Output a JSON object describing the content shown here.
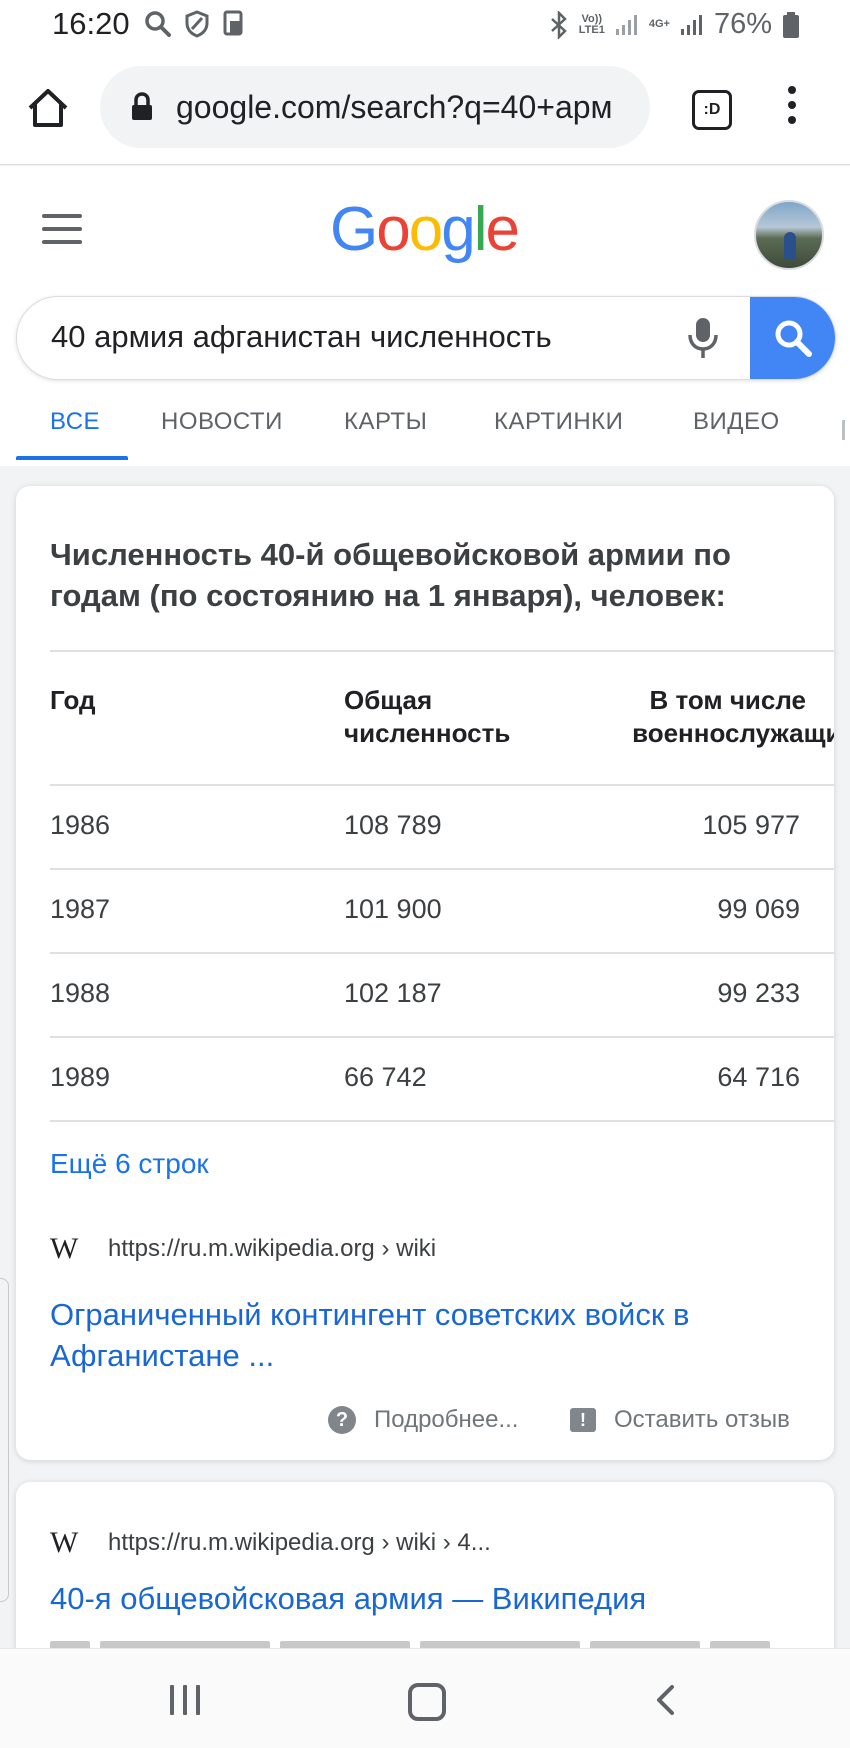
{
  "status": {
    "time": "16:20",
    "battery": "76%",
    "volte": "Vo))",
    "lte": "LTE1",
    "net": "4G+"
  },
  "browser": {
    "url": "google.com/search?q=40+арм",
    "tab_label": ":D"
  },
  "search": {
    "query": "40 армия афганистан численность"
  },
  "tabs": [
    "ВСЕ",
    "НОВОСТИ",
    "КАРТЫ",
    "КАРТИНКИ",
    "ВИДЕО"
  ],
  "snippet": {
    "title": "Численность 40-й общевойсковой армии по годам (по состоянию на 1 января), человек:",
    "headers": {
      "year": "Год",
      "total_1": "Общая",
      "total_2": "численность",
      "mil_1": "В том числе",
      "mil_2": "военнослужащих"
    },
    "rows": [
      {
        "year": "1986",
        "total": "108 789",
        "military": "105 977"
      },
      {
        "year": "1987",
        "total": "101 900",
        "military": "99 069"
      },
      {
        "year": "1988",
        "total": "102 187",
        "military": "99 233"
      },
      {
        "year": "1989",
        "total": "66 742",
        "military": "64 716"
      }
    ],
    "more_rows": "Ещё 6 строк",
    "source_logo": "W",
    "source_url": "https://ru.m.wikipedia.org › wiki",
    "link_line1": "Ограниченный контингент советских войск в",
    "link_line2": "Афганистане ...",
    "help_label": "Подробнее...",
    "feedback_label": "Оставить отзыв"
  },
  "result2": {
    "source_logo": "W",
    "source_url": "https://ru.m.wikipedia.org › wiki › 4...",
    "title": "40-я общевойсковая армия — Википедия"
  },
  "colors": {
    "accent": "#1a73e8",
    "link": "#1967d2",
    "search_button": "#4285f4"
  }
}
